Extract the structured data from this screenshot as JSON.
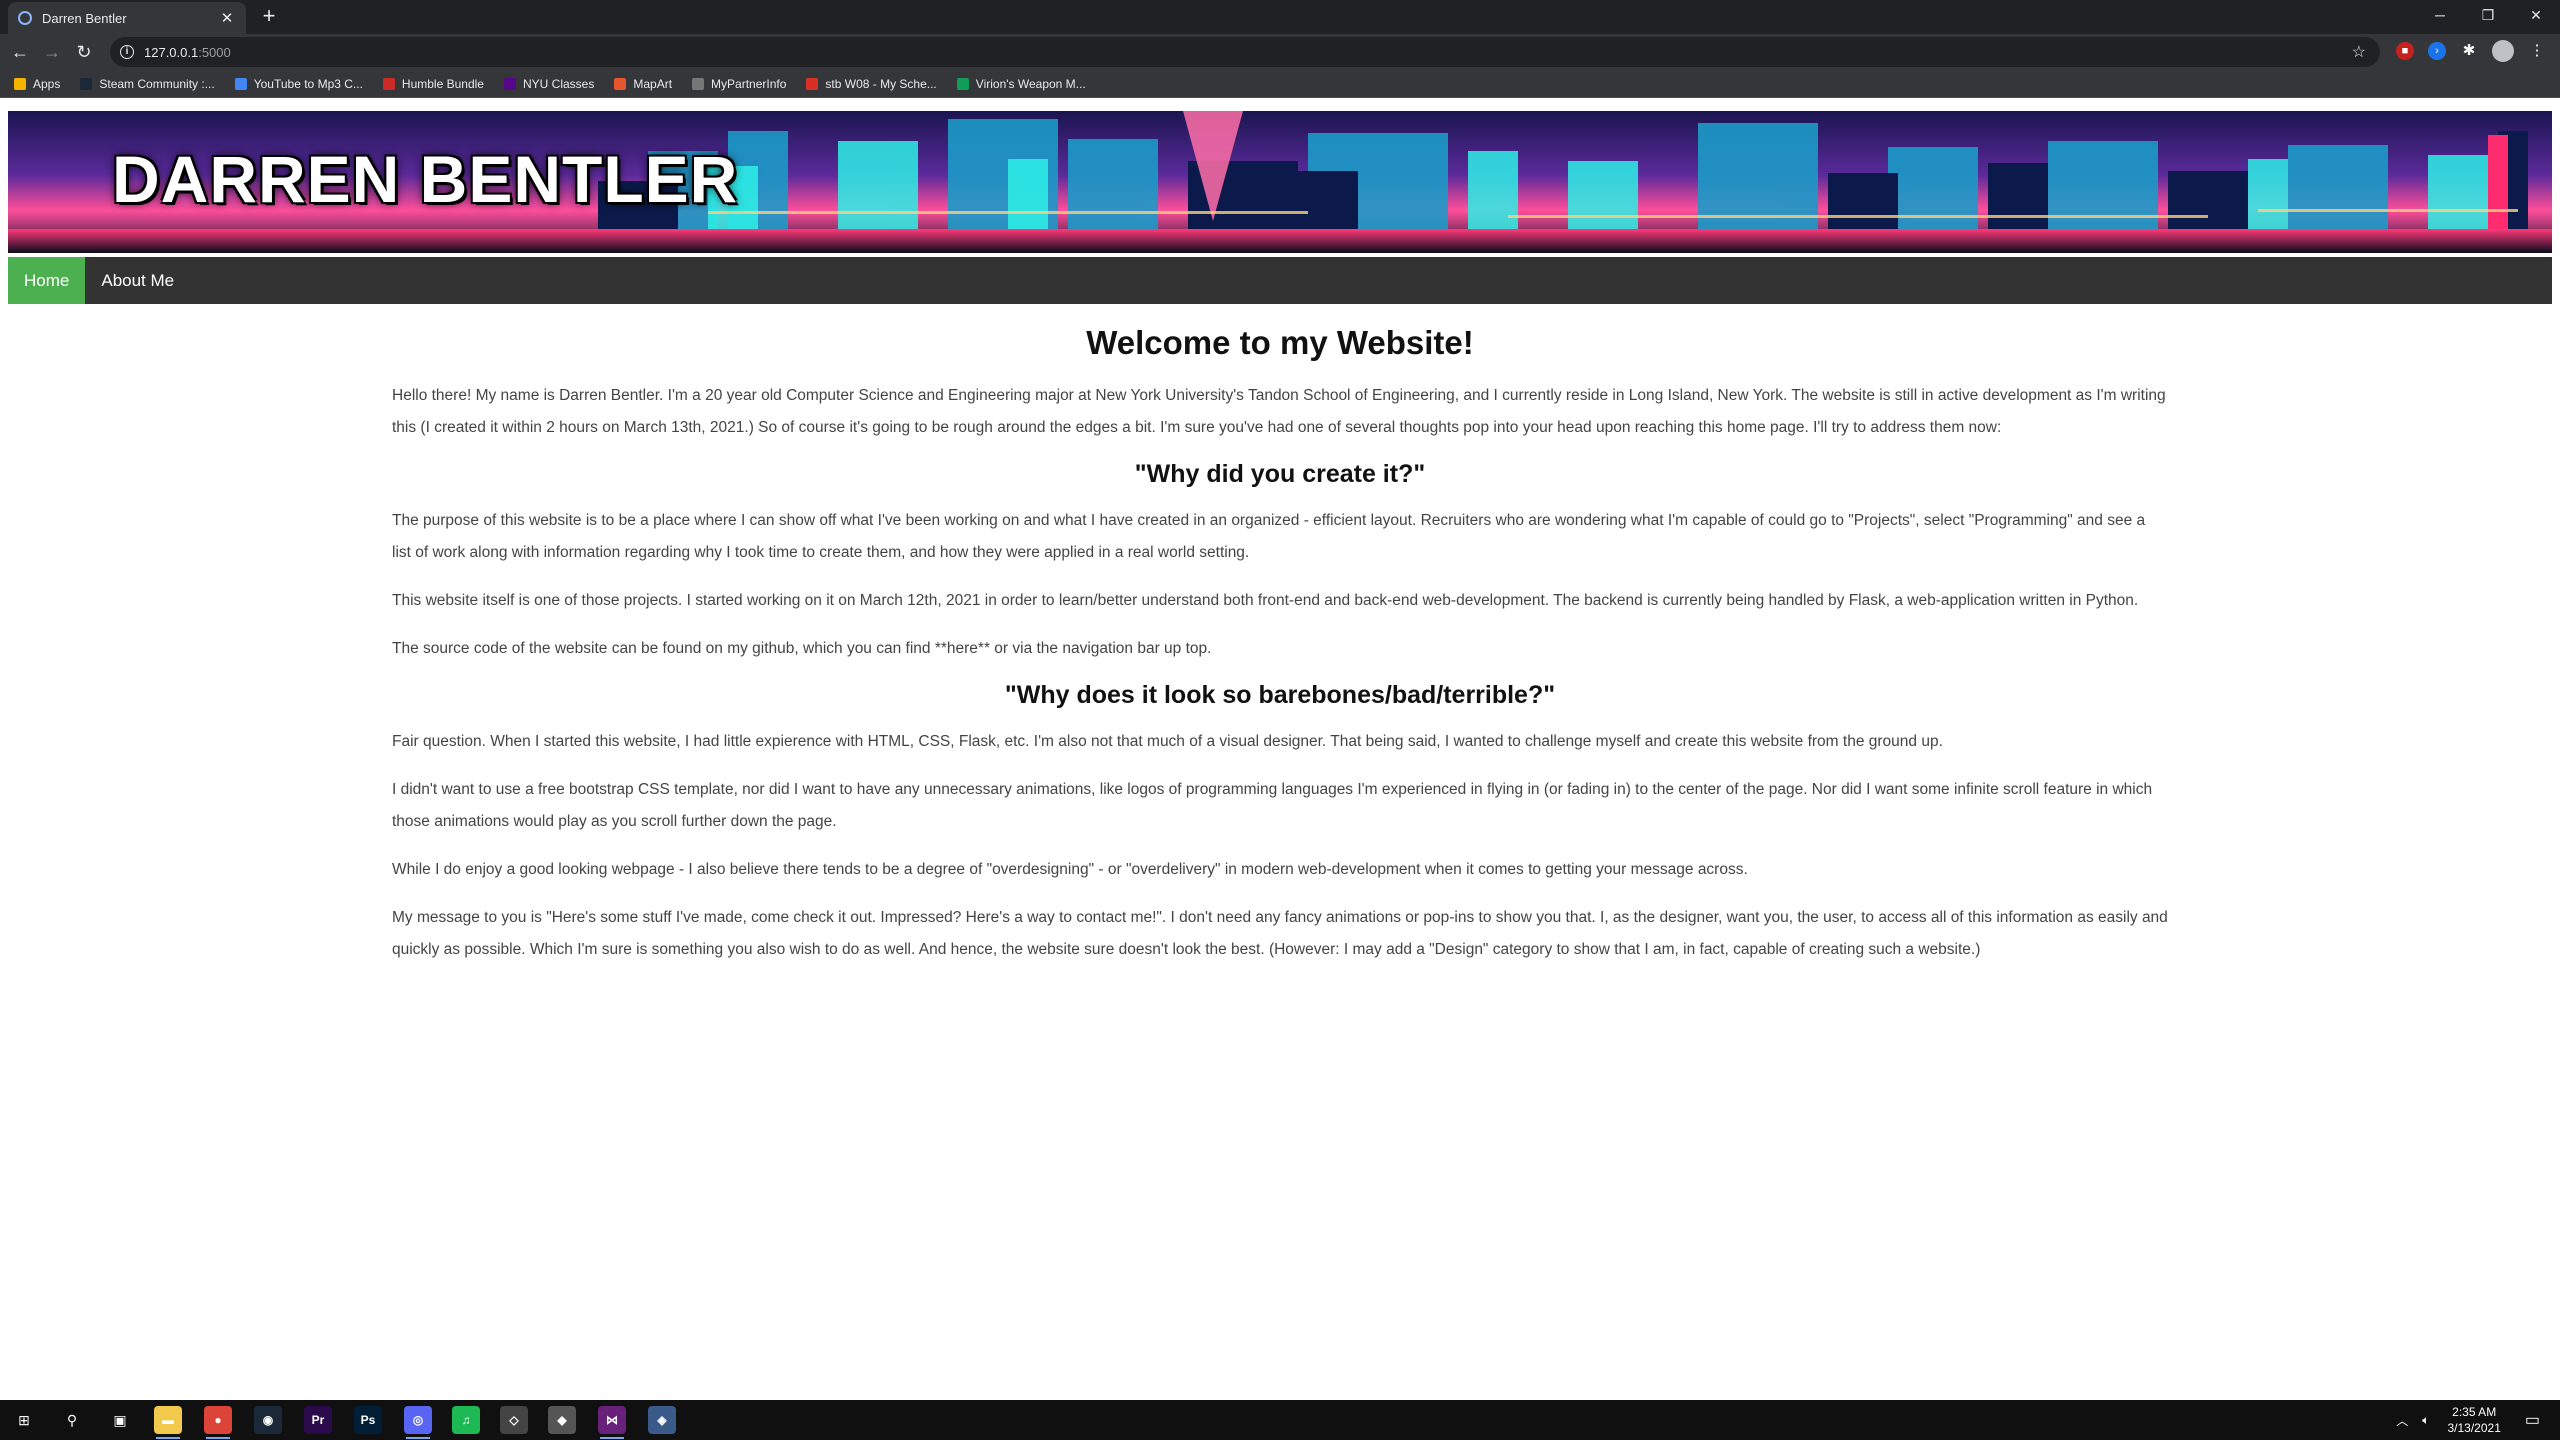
{
  "browser": {
    "tab_title": "Darren Bentler",
    "url_host": "127.0.0.1",
    "url_port": ":5000",
    "bookmarks": [
      {
        "label": "Apps",
        "color": "#f4b400"
      },
      {
        "label": "Steam Community :...",
        "color": "#1b2838"
      },
      {
        "label": "YouTube to Mp3 C...",
        "color": "#4285f4"
      },
      {
        "label": "Humble Bundle",
        "color": "#cc2929"
      },
      {
        "label": "NYU Classes",
        "color": "#57068c"
      },
      {
        "label": "MapArt",
        "color": "#e4572e"
      },
      {
        "label": "MyPartnerInfo",
        "color": "#777777"
      },
      {
        "label": "stb W08 - My Sche...",
        "color": "#d93025"
      },
      {
        "label": "Virion's Weapon M...",
        "color": "#0f9d58"
      }
    ]
  },
  "site": {
    "banner_title": "DARREN BENTLER",
    "nav": [
      {
        "label": "Home",
        "active": true
      },
      {
        "label": "About Me",
        "active": false
      }
    ],
    "heading": "Welcome to my Website!",
    "intro": "Hello there! My name is Darren Bentler. I'm a 20 year old Computer Science and Engineering major at New York University's Tandon School of Engineering, and I currently reside in Long Island, New York. The website is still in active development as I'm writing this (I created it within 2 hours on March 13th, 2021.) So of course it's going to be rough around the edges a bit. I'm sure you've had one of several thoughts pop into your head upon reaching this home page. I'll try to address them now:",
    "section1_heading": "\"Why did you create it?\"",
    "section1_p1": "The purpose of this website is to be a place where I can show off what I've been working on and what I have created in an organized - efficient layout. Recruiters who are wondering what I'm capable of could go to \"Projects\", select \"Programming\" and see a list of work along with information regarding why I took time to create them, and how they were applied in a real world setting.",
    "section1_p2": "This website itself is one of those projects. I started working on it on March 12th, 2021 in order to learn/better understand both front-end and back-end web-development. The backend is currently being handled by Flask, a web-application written in Python.",
    "section1_p3": "The source code of the website can be found on my github, which you can find **here** or via the navigation bar up top.",
    "section2_heading": "\"Why does it look so barebones/bad/terrible?\"",
    "section2_p1": "Fair question. When I started this website, I had little expierence with HTML, CSS, Flask, etc. I'm also not that much of a visual designer. That being said, I wanted to challenge myself and create this website from the ground up.",
    "section2_p2": "I didn't want to use a free bootstrap CSS template, nor did I want to have any unnecessary animations, like logos of programming languages I'm experienced in flying in (or fading in) to the center of the page. Nor did I want some infinite scroll feature in which those animations would play as you scroll further down the page.",
    "section2_p3": "While I do enjoy a good looking webpage - I also believe there tends to be a degree of \"overdesigning\" - or \"overdelivery\" in modern web-development when it comes to getting your message across.",
    "section2_p4": "My message to you is \"Here's some stuff I've made, come check it out. Impressed? Here's a way to contact me!\". I don't need any fancy animations or pop-ins to show you that. I, as the designer, want you, the user, to access all of this information as easily and quickly as possible. Which I'm sure is something you also wish to do as well. And hence, the website sure doesn't look the best. (However: I may add a \"Design\" category to show that I am, in fact, capable of creating such a website.)"
  },
  "taskbar": {
    "time": "2:35 AM",
    "date": "3/13/2021",
    "apps": [
      {
        "name": "start-icon",
        "glyph": "⊞",
        "color": "#101010"
      },
      {
        "name": "search-icon",
        "glyph": "⚲",
        "color": "#101010"
      },
      {
        "name": "task-view-icon",
        "glyph": "▣",
        "color": "#101010"
      },
      {
        "name": "file-explorer-icon",
        "glyph": "▬",
        "color": "#f2c94c"
      },
      {
        "name": "chrome-icon",
        "glyph": "●",
        "color": "#db4437"
      },
      {
        "name": "steam-icon",
        "glyph": "◉",
        "color": "#1b2838"
      },
      {
        "name": "premiere-icon",
        "glyph": "Pr",
        "color": "#2a0a4a"
      },
      {
        "name": "photoshop-icon",
        "glyph": "Ps",
        "color": "#001e36"
      },
      {
        "name": "discord-icon",
        "glyph": "◎",
        "color": "#5865f2"
      },
      {
        "name": "spotify-icon",
        "glyph": "♫",
        "color": "#1db954"
      },
      {
        "name": "app-icon",
        "glyph": "◇",
        "color": "#444444"
      },
      {
        "name": "app-icon-2",
        "glyph": "◆",
        "color": "#555555"
      },
      {
        "name": "visual-studio-icon",
        "glyph": "⋈",
        "color": "#68217a"
      },
      {
        "name": "app-icon-3",
        "glyph": "◈",
        "color": "#3a5a8a"
      }
    ]
  }
}
